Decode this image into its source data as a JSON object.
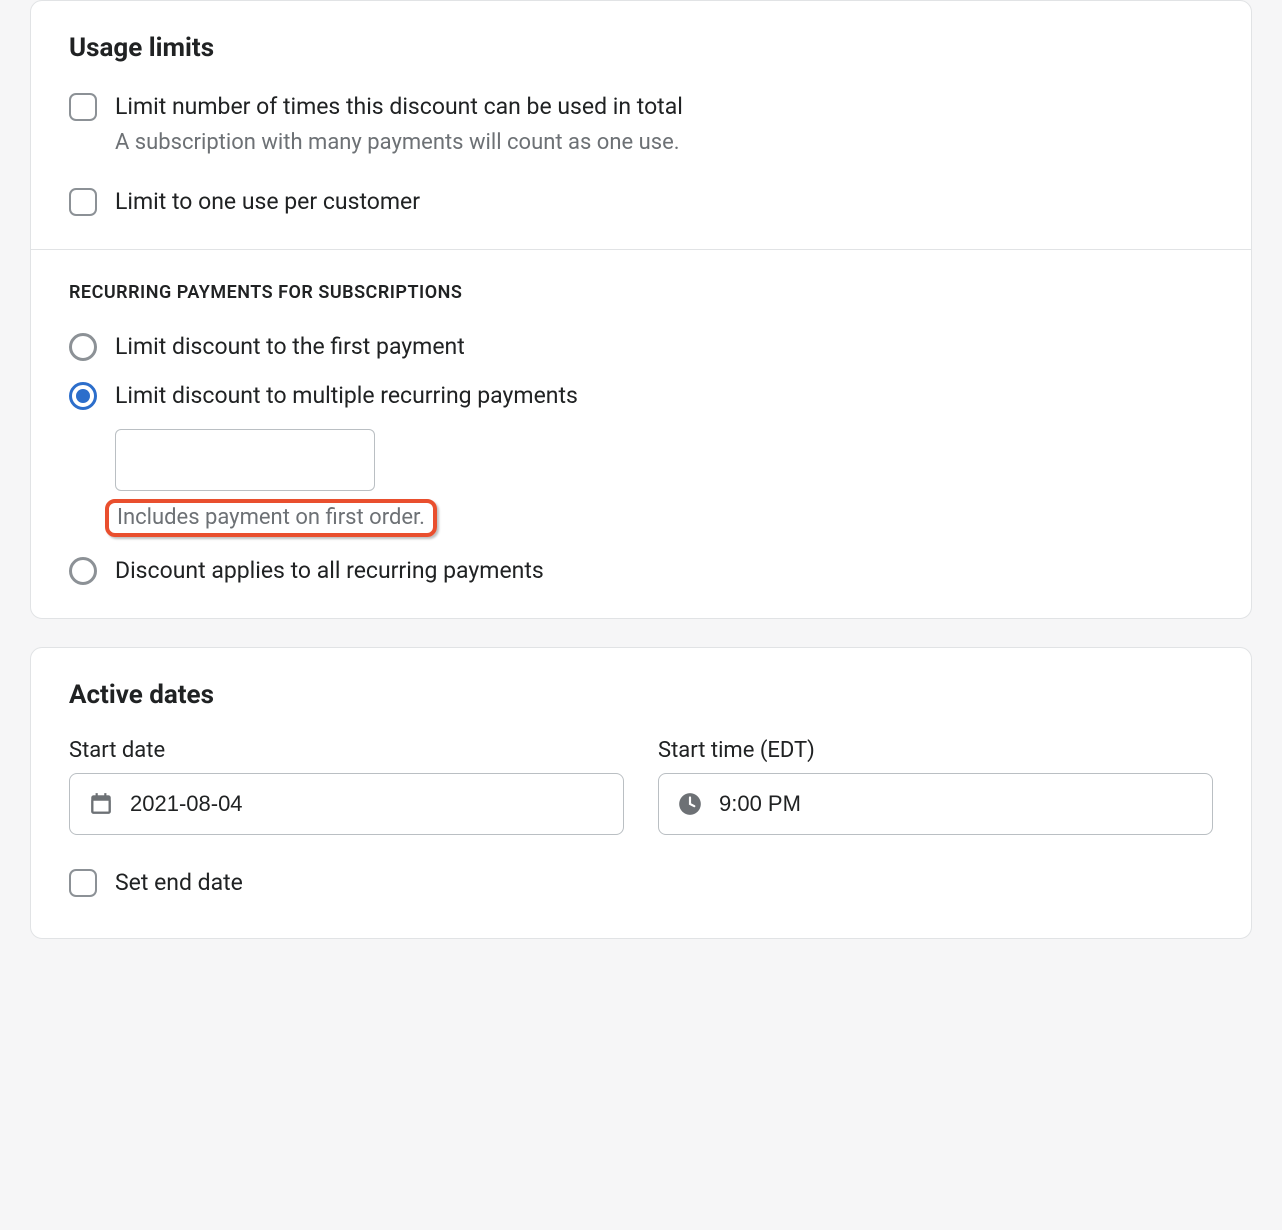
{
  "usage_limits": {
    "title": "Usage limits",
    "checkboxes": [
      {
        "id": "limit-total",
        "label": "Limit number of times this discount can be used in total",
        "sub": "A subscription with many payments will count as one use.",
        "checked": false
      },
      {
        "id": "limit-per-customer",
        "label": "Limit to one use per customer",
        "checked": false
      }
    ],
    "recurring": {
      "heading": "RECURRING PAYMENTS FOR SUBSCRIPTIONS",
      "options": [
        {
          "id": "first-payment",
          "label": "Limit discount to the first payment",
          "selected": false
        },
        {
          "id": "multiple-recurring",
          "label": "Limit discount to multiple recurring payments",
          "selected": true,
          "input_value": "",
          "helper": "Includes payment on first order."
        },
        {
          "id": "all-recurring",
          "label": "Discount applies to all recurring payments",
          "selected": false
        }
      ]
    }
  },
  "active_dates": {
    "title": "Active dates",
    "start_date_label": "Start date",
    "start_date_value": "2021-08-04",
    "start_time_label": "Start time (EDT)",
    "start_time_value": "9:00 PM",
    "set_end_date": {
      "label": "Set end date",
      "checked": false
    }
  },
  "icons": {
    "calendar": "calendar-icon",
    "clock": "clock-icon"
  }
}
